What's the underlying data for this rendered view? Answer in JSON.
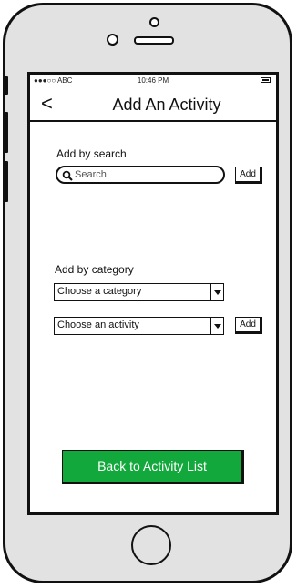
{
  "status_bar": {
    "carrier": "●●●○○ ABC",
    "time": "10:46 PM",
    "battery_icon": "battery-icon"
  },
  "nav": {
    "back_icon": "chevron-left-icon",
    "back_glyph": "<",
    "title": "Add An Activity"
  },
  "search_section": {
    "label": "Add by search",
    "placeholder": "Search",
    "add_label": "Add"
  },
  "category_section": {
    "label": "Add by category",
    "category_select": "Choose a category",
    "activity_select": "Choose an activity",
    "add_label": "Add"
  },
  "footer": {
    "back_to_list_label": "Back to Activity List"
  },
  "colors": {
    "primary_button": "#13a83c"
  }
}
